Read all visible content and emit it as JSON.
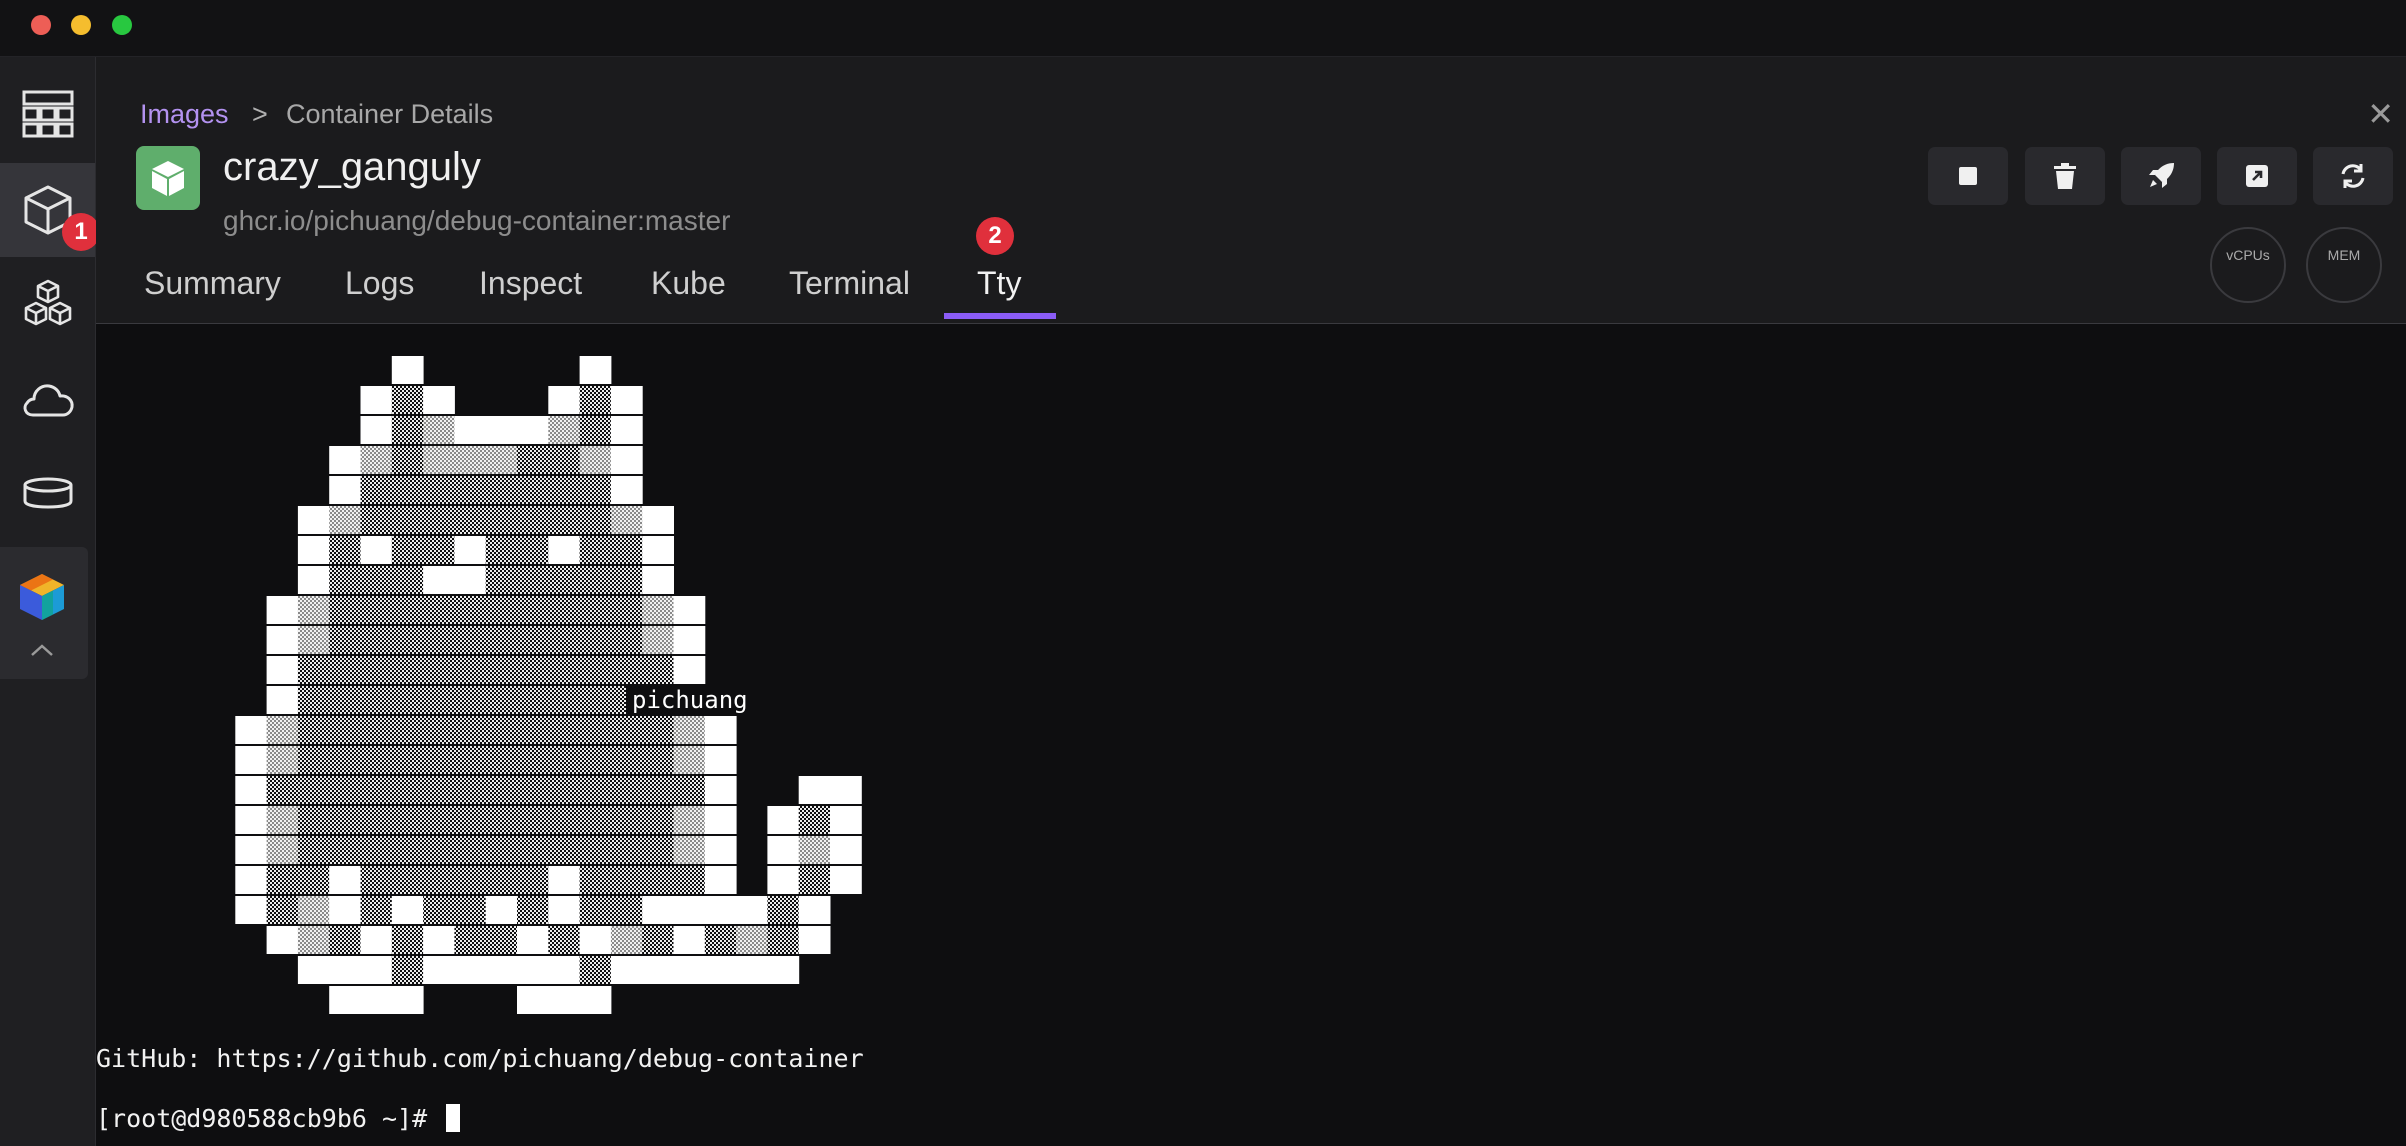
{
  "window": {
    "controls": [
      "close",
      "minimize",
      "maximize"
    ]
  },
  "colors": {
    "accent": "#8b5cf6",
    "badge": "#e0303c",
    "container_icon": "#5fae6c",
    "breadcrumb_link": "#b392f0"
  },
  "sidebar": {
    "items": [
      {
        "icon": "dashboard-icon"
      },
      {
        "icon": "container-icon",
        "active": true
      },
      {
        "icon": "pods-icon"
      },
      {
        "icon": "cloud-icon"
      },
      {
        "icon": "volume-icon"
      }
    ],
    "extension_icon": "extension-cube-icon",
    "collapse_icon": "chevron-up-icon",
    "badge_1": "1"
  },
  "breadcrumb": {
    "link": "Images",
    "separator": ">",
    "current": "Container Details"
  },
  "container": {
    "name": "crazy_ganguly",
    "image": "ghcr.io/pichuang/debug-container:master"
  },
  "actions": [
    "stop-icon",
    "trash-icon",
    "rocket-icon",
    "open-external-icon",
    "refresh-icon"
  ],
  "gauges": {
    "cpu_label": "vCPUs",
    "mem_label": "MEM"
  },
  "tabs": [
    "Summary",
    "Logs",
    "Inspect",
    "Kube",
    "Terminal",
    "Tty"
  ],
  "active_tab": "Tty",
  "badge_2": "2",
  "terminal": {
    "art_label": "pichuang",
    "github_line": "GitHub: https://github.com/pichuang/debug-container",
    "prompt": "[root@d980588cb9b6 ~]# "
  }
}
